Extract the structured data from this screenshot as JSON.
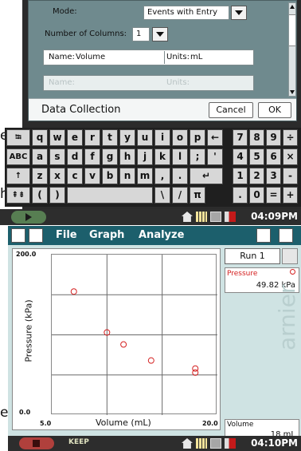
{
  "top_screen": {
    "dialog": {
      "mode_label": "Mode:",
      "mode_value": "Events with Entry",
      "columns_label": "Number of Columns:",
      "columns_value": "1",
      "name_label": "Name:",
      "name_value": "Volume",
      "units_label": "Units:",
      "units_value": "mL",
      "name2_label": "Name:",
      "units2_label": "Units:",
      "title": "Data Collection",
      "cancel": "Cancel",
      "ok": "OK"
    },
    "edge_letters": [
      "e",
      "h"
    ],
    "keyboard": {
      "row1": [
        "⭾",
        "q",
        "w",
        "e",
        "r",
        "t",
        "y",
        "u",
        "i",
        "o",
        "p",
        "←"
      ],
      "row2": [
        "ABC",
        "a",
        "s",
        "d",
        "f",
        "g",
        "h",
        "j",
        "k",
        "l",
        ";",
        "'"
      ],
      "row3": [
        "↑",
        "z",
        "x",
        "c",
        "v",
        "b",
        "n",
        "m",
        ",",
        ".",
        "↵"
      ],
      "row4": [
        "⇞⇟",
        "(",
        ")",
        "",
        "\\",
        "/",
        "π"
      ],
      "numpad": [
        [
          "7",
          "8",
          "9",
          "÷"
        ],
        [
          "4",
          "5",
          "6",
          "×"
        ],
        [
          "1",
          "2",
          "3",
          "-"
        ],
        [
          ".",
          "0",
          "=",
          "+"
        ]
      ]
    },
    "taskbar": {
      "time": "04:09PM"
    }
  },
  "bottom_screen": {
    "menu": {
      "file": "File",
      "graph": "Graph",
      "analyze": "Analyze"
    },
    "edge_letter": "e",
    "watermark": "arnier",
    "graph": {
      "y_axis_title": "Pressure (kPa)",
      "x_axis_title": "Volume (mL)",
      "y_max_label": "200.0",
      "y_min_label": "0.0",
      "x_min_label": "5.0",
      "x_max_label": "20.0"
    },
    "run": {
      "label": "Run 1"
    },
    "meters": {
      "pressure_name": "Pressure",
      "pressure_value": "49.82 kPa",
      "volume_name": "Volume",
      "volume_value": "18 mL"
    },
    "taskbar": {
      "keep": "KEEP",
      "time": "04:10PM"
    }
  },
  "chart_data": {
    "type": "scatter",
    "xlabel": "Volume (mL)",
    "ylabel": "Pressure (kPa)",
    "xlim": [
      5.0,
      20.0
    ],
    "ylim": [
      0.0,
      200.0
    ],
    "grid": true,
    "points": [
      {
        "x": 7.0,
        "y": 154
      },
      {
        "x": 10.0,
        "y": 103
      },
      {
        "x": 11.5,
        "y": 88
      },
      {
        "x": 14.0,
        "y": 68
      },
      {
        "x": 18.0,
        "y": 58
      },
      {
        "x": 18.0,
        "y": 53
      }
    ]
  },
  "colors": {
    "menubar": "#1c5f6c",
    "panel": "#cfe3e3",
    "marker": "#d42020",
    "pressure_label": "#d42020"
  }
}
